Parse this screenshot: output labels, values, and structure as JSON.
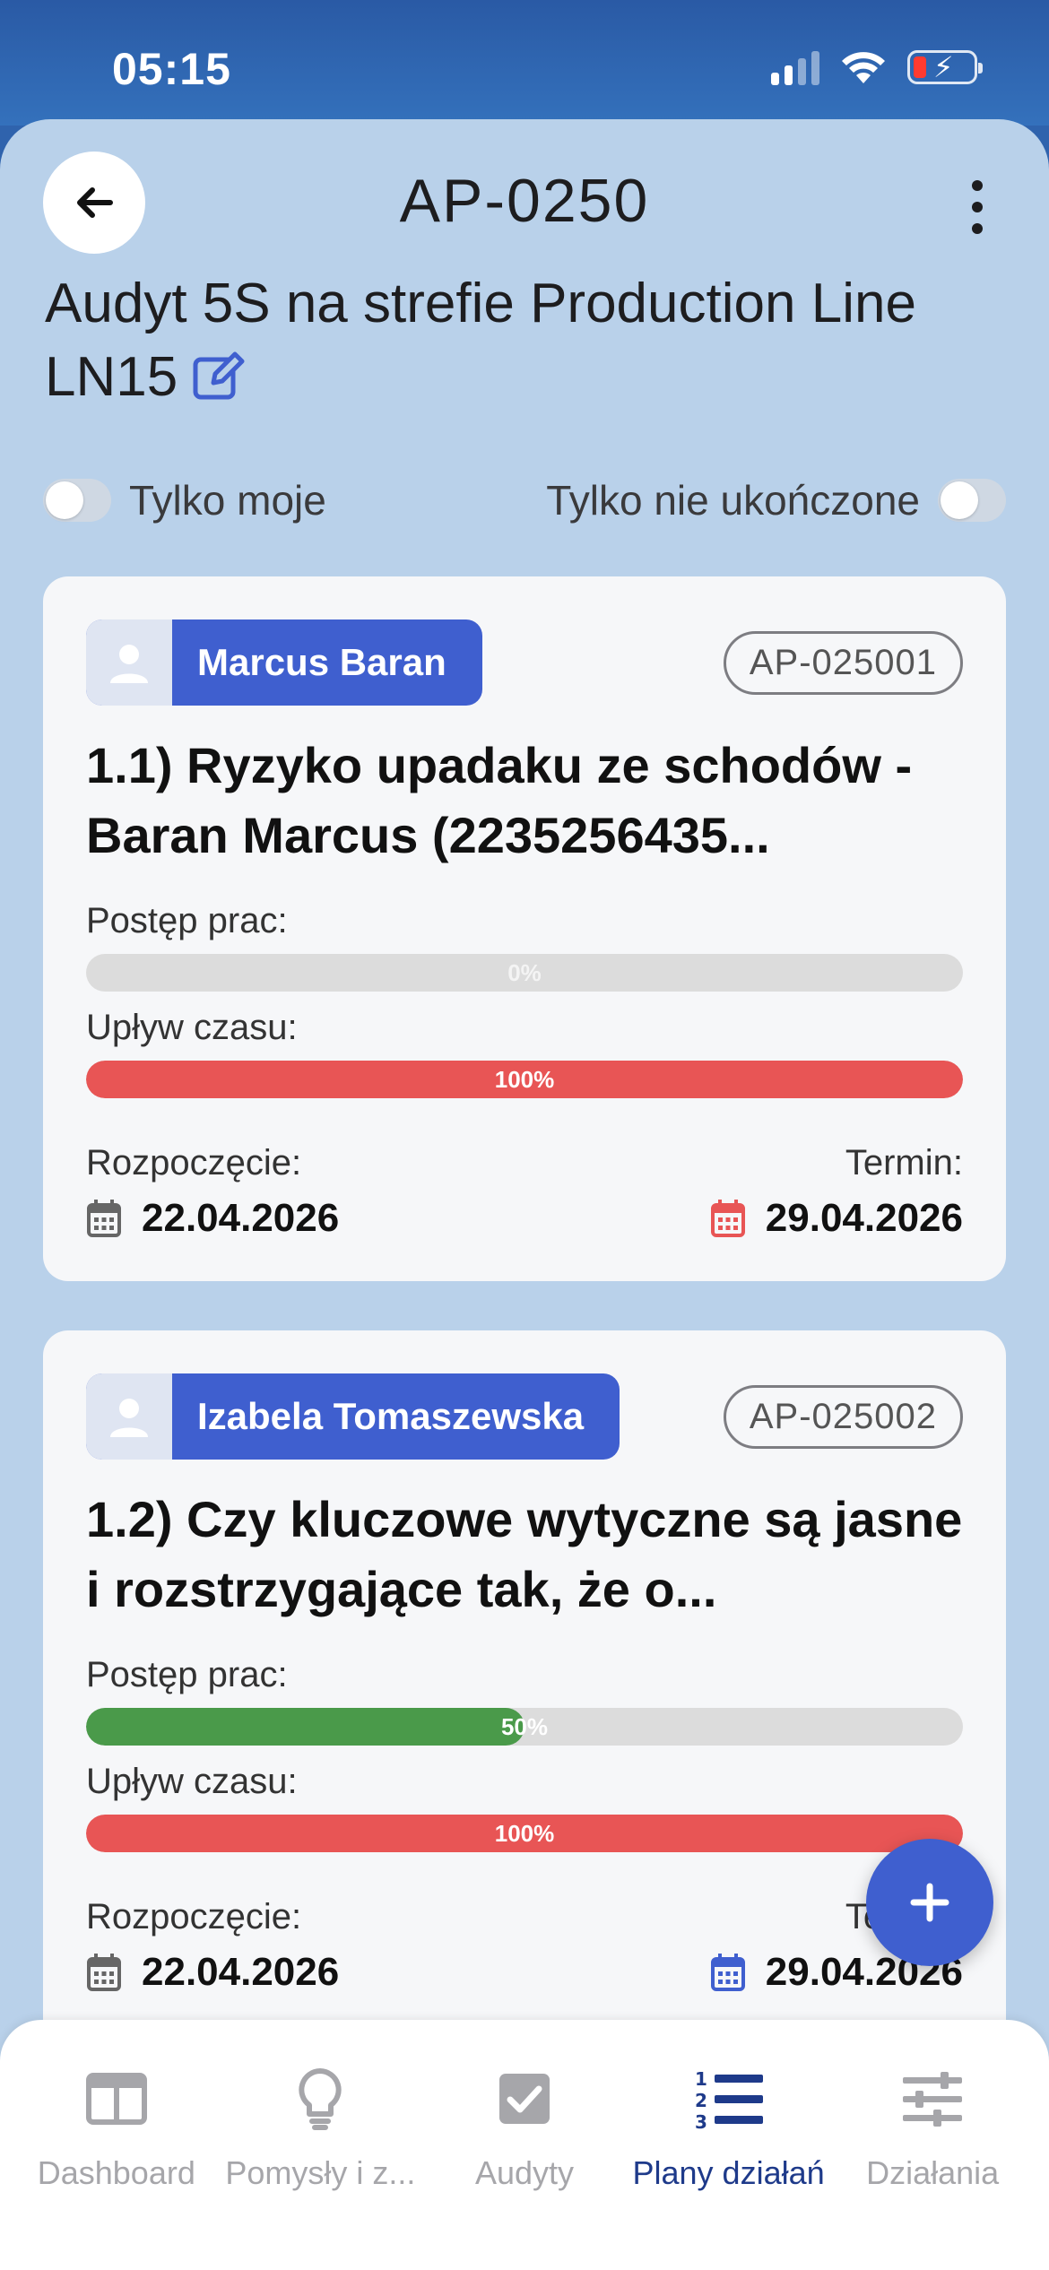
{
  "status_bar": {
    "time": "05:15"
  },
  "header": {
    "code": "AP-0250",
    "title": "Audyt 5S na strefie Production Line LN15"
  },
  "filters": {
    "only_mine": "Tylko moje",
    "only_unfinished": "Tylko nie ukończone"
  },
  "cards": [
    {
      "assignee": "Marcus Baran",
      "code": "AP-025001",
      "title": "1.1) Ryzyko upadaku ze schodów - Baran Marcus (2235256435...",
      "progress_label": "Postęp prac:",
      "progress_value": 0,
      "progress_text": "0%",
      "time_label": "Upływ czasu:",
      "time_value": 100,
      "time_text": "100%",
      "start_label": "Rozpoczęcie:",
      "start_date": "22.04.2026",
      "due_label": "Termin:",
      "due_date": "29.04.2026"
    },
    {
      "assignee": "Izabela Tomaszewska",
      "code": "AP-025002",
      "title": "1.2) Czy kluczowe wytyczne są jasne i rozstrzygające tak, że o...",
      "progress_label": "Postęp prac:",
      "progress_value": 50,
      "progress_text": "50%",
      "time_label": "Upływ czasu:",
      "time_value": 100,
      "time_text": "100%",
      "start_label": "Rozpoczęcie:",
      "start_date": "22.04.2026",
      "due_label": "Termin:",
      "due_date": "29.04.2026"
    }
  ],
  "tabs": [
    {
      "label": "Dashboard",
      "icon": "dashboard-icon",
      "active": false
    },
    {
      "label": "Pomysły i z...",
      "icon": "lightbulb-icon",
      "active": false
    },
    {
      "label": "Audyty",
      "icon": "checkbox-icon",
      "active": false
    },
    {
      "label": "Plany działań",
      "icon": "numbered-list-icon",
      "active": true
    },
    {
      "label": "Działania",
      "icon": "sliders-icon",
      "active": false
    }
  ],
  "colors": {
    "accent": "#3f5fcf",
    "progress_green": "#4a9a4a",
    "time_red": "#e85555",
    "due_red": "#e85555",
    "due_blue": "#3f5fcf",
    "active_tab": "#1e3a8a"
  }
}
